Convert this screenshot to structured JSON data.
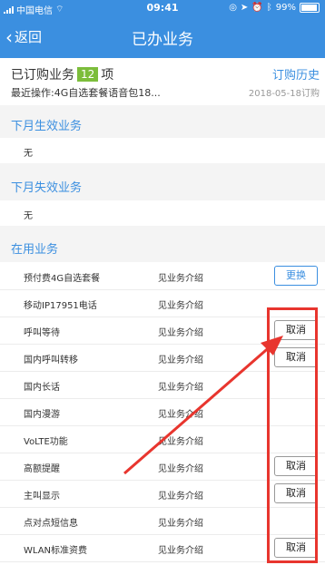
{
  "status_bar": {
    "carrier": "中国电信",
    "time": "09:41",
    "battery": "99%"
  },
  "nav": {
    "back_label": "返回",
    "title": "已办业务"
  },
  "summary": {
    "ordered_prefix": "已订购业务",
    "ordered_count": "12",
    "ordered_suffix": "项",
    "last_operation": "最近操作:4G自选套餐语音包18...",
    "history_link": "订购历史",
    "last_date": "2018-05-18订购"
  },
  "sections": {
    "next_month_effective": "下月生效业务",
    "next_month_effective_value": "无",
    "next_month_expire": "下月失效业务",
    "next_month_expire_value": "无",
    "in_use": "在用业务"
  },
  "services": [
    {
      "name": "预付费4G自选套餐",
      "desc": "见业务介绍",
      "action": "更换"
    },
    {
      "name": "移动IP17951电话",
      "desc": "见业务介绍",
      "action": ""
    },
    {
      "name": "呼叫等待",
      "desc": "见业务介绍",
      "action": "取消"
    },
    {
      "name": "国内呼叫转移",
      "desc": "见业务介绍",
      "action": "取消"
    },
    {
      "name": "国内长话",
      "desc": "见业务介绍",
      "action": ""
    },
    {
      "name": "国内漫游",
      "desc": "见业务介绍",
      "action": ""
    },
    {
      "name": "VoLTE功能",
      "desc": "见业务介绍",
      "action": ""
    },
    {
      "name": "高额提醒",
      "desc": "见业务介绍",
      "action": "取消"
    },
    {
      "name": "主叫显示",
      "desc": "见业务介绍",
      "action": "取消"
    },
    {
      "name": "点对点短信息",
      "desc": "见业务介绍",
      "action": ""
    },
    {
      "name": "WLAN标准资费",
      "desc": "见业务介绍",
      "action": "取消"
    }
  ],
  "colors": {
    "header": "#3b8fe0",
    "badge": "#7cbd3b",
    "annotation": "#e8352e"
  }
}
